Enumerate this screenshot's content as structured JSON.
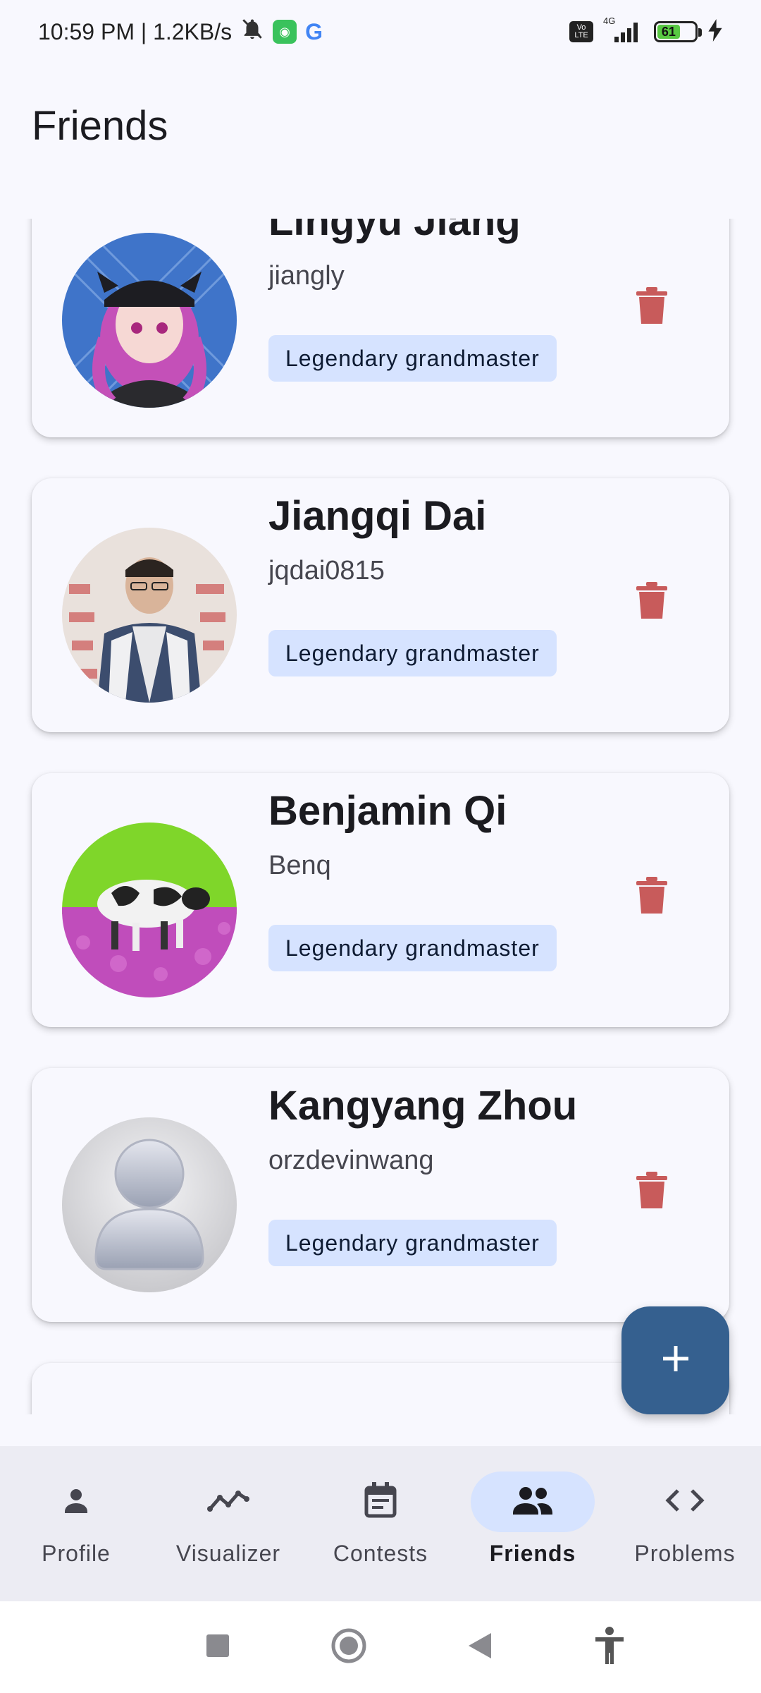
{
  "status_bar": {
    "time_speed": "10:59 PM | 1.2KB/s",
    "network": "4G",
    "volte": "Vo LTE",
    "battery": "61"
  },
  "page": {
    "title": "Friends"
  },
  "friends": [
    {
      "name": "Lingyu Jiang",
      "handle": "jiangly",
      "rank": "Legendary grandmaster",
      "avatar": "anime-girl-avatar"
    },
    {
      "name": "Jiangqi Dai",
      "handle": "jqdai0815",
      "rank": "Legendary grandmaster",
      "avatar": "photo-avatar"
    },
    {
      "name": "Benjamin Qi",
      "handle": "Benq",
      "rank": "Legendary grandmaster",
      "avatar": "cow-avatar"
    },
    {
      "name": "Kangyang Zhou",
      "handle": "orzdevinwang",
      "rank": "Legendary grandmaster",
      "avatar": "default-user-avatar"
    }
  ],
  "fab": {
    "icon": "plus-icon"
  },
  "nav": {
    "items": [
      {
        "label": "Profile",
        "icon": "person-icon"
      },
      {
        "label": "Visualizer",
        "icon": "line-chart-icon"
      },
      {
        "label": "Contests",
        "icon": "calendar-icon"
      },
      {
        "label": "Friends",
        "icon": "people-icon",
        "active": true
      },
      {
        "label": "Problems",
        "icon": "code-icon"
      }
    ]
  },
  "colors": {
    "accent": "#35608f",
    "chip": "#d6e3ff",
    "delete": "#c85b5b"
  }
}
